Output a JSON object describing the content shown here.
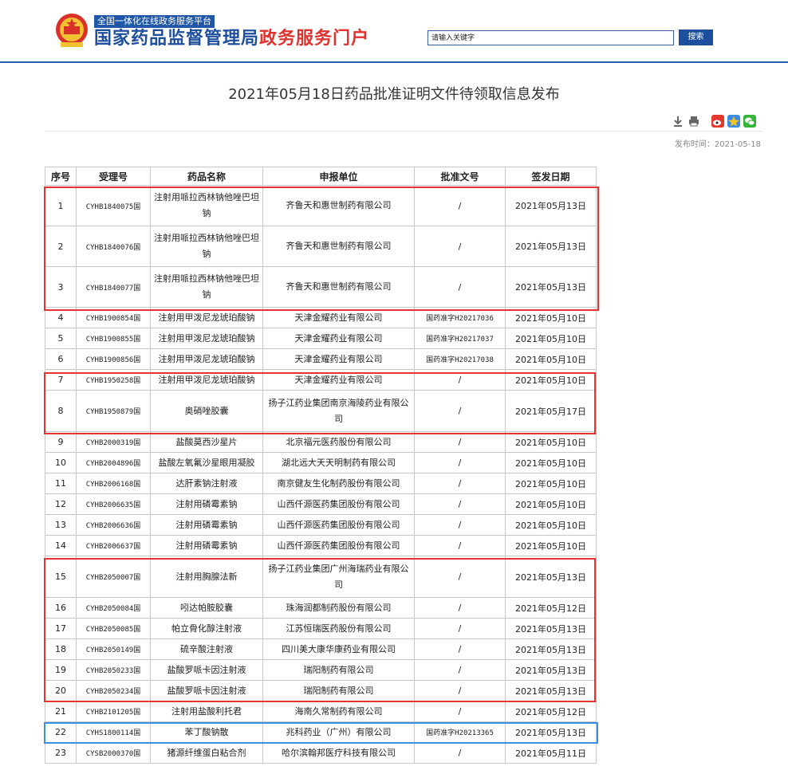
{
  "header": {
    "platform_banner": "全国一体化在线政务服务平台",
    "portal_title_main": "国家药品监督管理局",
    "portal_title_accent": "政务服务门户",
    "search": {
      "placeholder": "请输入关键字",
      "button_label": "搜索"
    }
  },
  "article": {
    "title": "2021年05月18日药品批准证明文件待领取信息发布",
    "publish_time": "发布时间：2021-05-18",
    "tool_icons": [
      "download-icon",
      "print-icon",
      "weibo-icon",
      "qzone-icon",
      "wechat-icon"
    ]
  },
  "colors": {
    "header_blue": "#1f4e9c",
    "highlight_red": "#e53333",
    "highlight_blue": "#3b8fe0"
  },
  "table": {
    "headers": [
      "序号",
      "受理号",
      "药品名称",
      "申报单位",
      "批准文号",
      "签发日期"
    ],
    "rows": [
      {
        "no": "1",
        "code": "CYHB1840075国",
        "drug": "注射用哌拉西林钠他唑巴坦钠",
        "company": "齐鲁天和惠世制药有限公司",
        "approval": "/",
        "date": "2021年05月13日"
      },
      {
        "no": "2",
        "code": "CYHB1840076国",
        "drug": "注射用哌拉西林钠他唑巴坦钠",
        "company": "齐鲁天和惠世制药有限公司",
        "approval": "/",
        "date": "2021年05月13日"
      },
      {
        "no": "3",
        "code": "CYHB1840077国",
        "drug": "注射用哌拉西林钠他唑巴坦钠",
        "company": "齐鲁天和惠世制药有限公司",
        "approval": "/",
        "date": "2021年05月13日"
      },
      {
        "no": "4",
        "code": "CYHB1900854国",
        "drug": "注射用甲泼尼龙琥珀酸钠",
        "company": "天津金耀药业有限公司",
        "approval": "国药准字H20217036",
        "date": "2021年05月10日"
      },
      {
        "no": "5",
        "code": "CYHB1900855国",
        "drug": "注射用甲泼尼龙琥珀酸钠",
        "company": "天津金耀药业有限公司",
        "approval": "国药准字H20217037",
        "date": "2021年05月10日"
      },
      {
        "no": "6",
        "code": "CYHB1900856国",
        "drug": "注射用甲泼尼龙琥珀酸钠",
        "company": "天津金耀药业有限公司",
        "approval": "国药准字H20217038",
        "date": "2021年05月10日"
      },
      {
        "no": "7",
        "code": "CYHB1950258国",
        "drug": "注射用甲泼尼龙琥珀酸钠",
        "company": "天津金耀药业有限公司",
        "approval": "/",
        "date": "2021年05月10日"
      },
      {
        "no": "8",
        "code": "CYHB1950879国",
        "drug": "奥硝唑胶囊",
        "company": "扬子江药业集团南京海陵药业有限公司",
        "approval": "/",
        "date": "2021年05月17日"
      },
      {
        "no": "9",
        "code": "CYHB2000319国",
        "drug": "盐酸莫西沙星片",
        "company": "北京福元医药股份有限公司",
        "approval": "/",
        "date": "2021年05月10日"
      },
      {
        "no": "10",
        "code": "CYHB2004896国",
        "drug": "盐酸左氧氟沙星眼用凝胶",
        "company": "湖北远大天天明制药有限公司",
        "approval": "/",
        "date": "2021年05月10日"
      },
      {
        "no": "11",
        "code": "CYHB2006168国",
        "drug": "达肝素钠注射液",
        "company": "南京健友生化制药股份有限公司",
        "approval": "/",
        "date": "2021年05月10日"
      },
      {
        "no": "12",
        "code": "CYHB2006635国",
        "drug": "注射用磷霉素钠",
        "company": "山西仟源医药集团股份有限公司",
        "approval": "/",
        "date": "2021年05月10日"
      },
      {
        "no": "13",
        "code": "CYHB2006636国",
        "drug": "注射用磷霉素钠",
        "company": "山西仟源医药集团股份有限公司",
        "approval": "/",
        "date": "2021年05月10日"
      },
      {
        "no": "14",
        "code": "CYHB2006637国",
        "drug": "注射用磷霉素钠",
        "company": "山西仟源医药集团股份有限公司",
        "approval": "/",
        "date": "2021年05月10日"
      },
      {
        "no": "15",
        "code": "CYHB2050007国",
        "drug": "注射用胸腺法新",
        "company": "扬子江药业集团广州海瑞药业有限公司",
        "approval": "/",
        "date": "2021年05月13日"
      },
      {
        "no": "16",
        "code": "CYHB2050084国",
        "drug": "吲达帕胺胶囊",
        "company": "珠海润都制药股份有限公司",
        "approval": "/",
        "date": "2021年05月12日"
      },
      {
        "no": "17",
        "code": "CYHB2050085国",
        "drug": "帕立骨化醇注射液",
        "company": "江苏恒瑞医药股份有限公司",
        "approval": "/",
        "date": "2021年05月13日"
      },
      {
        "no": "18",
        "code": "CYHB2050149国",
        "drug": "硫辛酸注射液",
        "company": "四川美大康华康药业有限公司",
        "approval": "/",
        "date": "2021年05月13日"
      },
      {
        "no": "19",
        "code": "CYHB2050233国",
        "drug": "盐酸罗哌卡因注射液",
        "company": "瑞阳制药有限公司",
        "approval": "/",
        "date": "2021年05月13日"
      },
      {
        "no": "20",
        "code": "CYHB2050234国",
        "drug": "盐酸罗哌卡因注射液",
        "company": "瑞阳制药有限公司",
        "approval": "/",
        "date": "2021年05月13日"
      },
      {
        "no": "21",
        "code": "CYHB2101205国",
        "drug": "注射用盐酸利托君",
        "company": "海南久常制药有限公司",
        "approval": "/",
        "date": "2021年05月12日"
      },
      {
        "no": "22",
        "code": "CYHS1800114国",
        "drug": "苯丁酸钠散",
        "company": "兆科药业（广州）有限公司",
        "approval": "国药准字H20213365",
        "date": "2021年05月13日"
      },
      {
        "no": "23",
        "code": "CYSB2000370国",
        "drug": "猪源纤维蛋白粘合剂",
        "company": "哈尔滨翰邦医疗科技有限公司",
        "approval": "/",
        "date": "2021年05月11日"
      }
    ]
  }
}
